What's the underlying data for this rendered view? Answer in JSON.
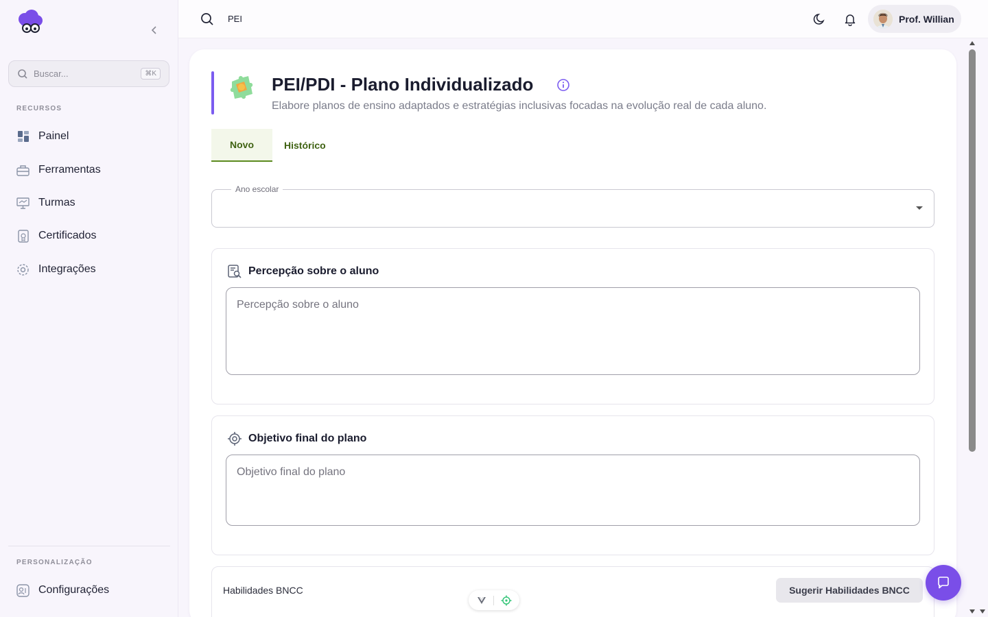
{
  "sidebar": {
    "search_placeholder": "Buscar...",
    "search_shortcut": "⌘K",
    "section_resources": "RECURSOS",
    "items": [
      {
        "label": "Painel",
        "icon": "dashboard-icon"
      },
      {
        "label": "Ferramentas",
        "icon": "toolbox-icon"
      },
      {
        "label": "Turmas",
        "icon": "classroom-icon"
      },
      {
        "label": "Certificados",
        "icon": "certificate-icon"
      },
      {
        "label": "Integrações",
        "icon": "gear-icon"
      }
    ],
    "section_personal": "PERSONALIZAÇÃO",
    "settings_label": "Configurações"
  },
  "topbar": {
    "search_value": "PEI",
    "user_name": "Prof. Willian"
  },
  "page": {
    "title": "PEI/PDI - Plano Individualizado",
    "subtitle": "Elabore planos de ensino adaptados e estratégias inclusivas focadas na evolução real de cada aluno.",
    "tabs": [
      {
        "label": "Novo",
        "active": true
      },
      {
        "label": "Histórico",
        "active": false
      }
    ],
    "school_year": {
      "label": "Ano escolar",
      "value": ""
    },
    "perception": {
      "title": "Percepção sobre o aluno",
      "placeholder": "Percepção sobre o aluno"
    },
    "objective": {
      "title": "Objetivo final do plano",
      "placeholder": "Objetivo final do plano"
    },
    "bncc": {
      "label": "Habilidades BNCC",
      "button": "Sugerir Habilidades BNCC"
    }
  },
  "colors": {
    "accent": "#7b5cf0",
    "tab_active": "#3f6212",
    "chat_fab": "#7a4ee8"
  }
}
